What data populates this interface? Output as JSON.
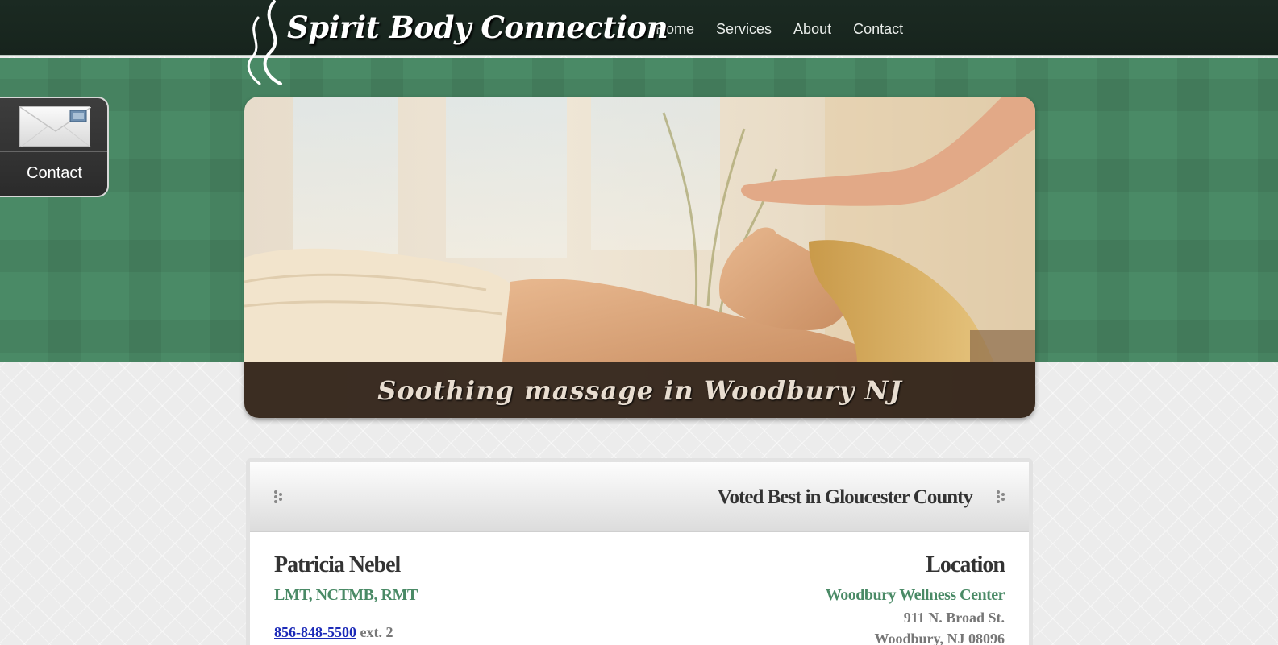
{
  "header": {
    "logo_text": "Spirit Body Connection",
    "nav": [
      {
        "label": "Home"
      },
      {
        "label": "Services"
      },
      {
        "label": "About"
      },
      {
        "label": "Contact"
      }
    ]
  },
  "contact_tab": {
    "label": "Contact",
    "icon": "envelope-icon"
  },
  "hero": {
    "caption": "Soothing massage in Woodbury NJ"
  },
  "panel": {
    "title": "Voted Best in Gloucester County",
    "left": {
      "name": "Patricia Nebel",
      "credentials": "LMT, NCTMB, RMT",
      "phone": "856-848-5500",
      "extension": "ext. 2"
    },
    "right": {
      "title": "Location",
      "center": "Woodbury Wellness Center",
      "address_line1": "911 N. Broad St.",
      "address_line2": "Woodbury, NJ 08096"
    }
  },
  "colors": {
    "header_bg": "#1b2a22",
    "accent_green": "#4a8a66",
    "link_blue": "#1d2bb8"
  }
}
